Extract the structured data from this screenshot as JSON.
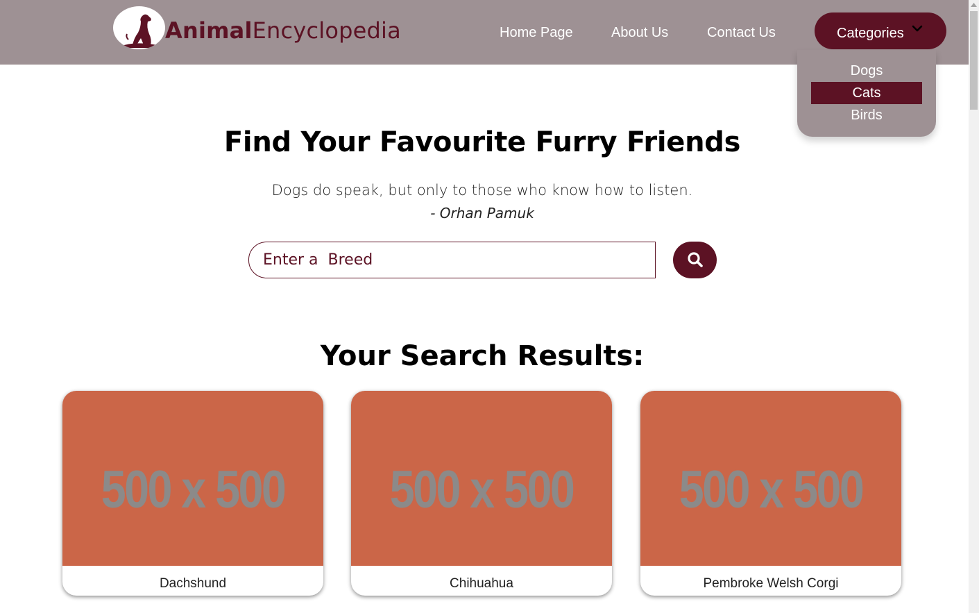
{
  "header": {
    "brand_bold": "Animal",
    "brand_light": "Encyclopedia",
    "nav": {
      "home": "Home Page",
      "about": "About Us",
      "contact": "Contact Us"
    },
    "categories_label": "Categories",
    "dropdown": [
      "Dogs",
      "Cats",
      "Birds"
    ],
    "dropdown_selected": "Cats"
  },
  "hero": {
    "title": "Find Your Favourite Furry Friends",
    "quote": "Dogs do speak, but only to those who know how to listen.",
    "author": "- Orhan Pamuk"
  },
  "search": {
    "placeholder": "Enter a  Breed"
  },
  "results": {
    "title": "Your Search Results:",
    "image_placeholder": "500 x 500",
    "cards": [
      "Dachshund",
      "Chihuahua",
      "Pembroke Welsh Corgi"
    ]
  },
  "colors": {
    "header_bg": "#9e9194",
    "brand": "#5c1224",
    "card_image": "#cb6648"
  },
  "icons": {
    "logo": "dog-silhouette-icon",
    "dropdown": "chevron-down-icon",
    "search": "search-icon"
  }
}
